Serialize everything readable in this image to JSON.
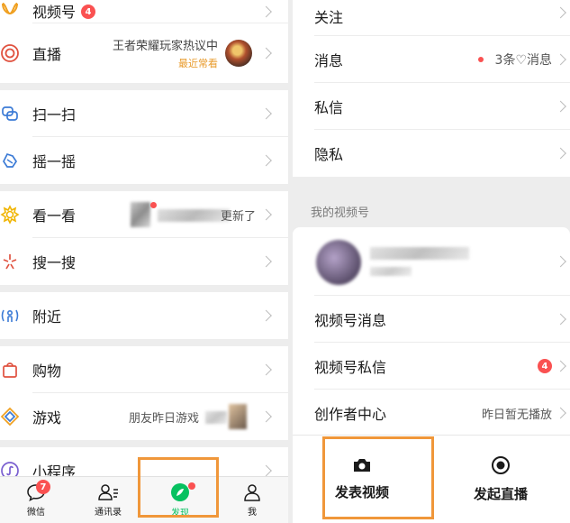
{
  "left": {
    "items": {
      "channels": {
        "label": "视频号",
        "badge": "4"
      },
      "live": {
        "label": "直播",
        "subtitle": "王者荣耀玩家热议中",
        "note": "最近常看"
      },
      "scan": {
        "label": "扫一扫"
      },
      "shake": {
        "label": "摇一摇"
      },
      "top_stories": {
        "label": "看一看",
        "subtitle": "更新了"
      },
      "search": {
        "label": "搜一搜"
      },
      "nearby": {
        "label": "附近"
      },
      "shopping": {
        "label": "购物"
      },
      "games": {
        "label": "游戏",
        "subtitle": "朋友昨日游戏"
      },
      "mini_programs": {
        "label": "小程序"
      }
    },
    "tabbar": {
      "chats": {
        "label": "微信",
        "badge": "7"
      },
      "contacts": {
        "label": "通讯录"
      },
      "discover": {
        "label": "发现"
      },
      "me": {
        "label": "我"
      }
    }
  },
  "right": {
    "items": {
      "follow": {
        "label": "关注"
      },
      "messages": {
        "label": "消息",
        "value": "3条♡消息"
      },
      "private_msg": {
        "label": "私信"
      },
      "privacy": {
        "label": "隐私"
      }
    },
    "section_label": "我的视频号",
    "channel_items": {
      "channel_messages": {
        "label": "视频号消息"
      },
      "channel_private": {
        "label": "视频号私信",
        "badge": "4"
      },
      "creator_center": {
        "label": "创作者中心",
        "value": "昨日暂无播放"
      }
    },
    "sheet": {
      "post_video": {
        "label": "发表视频"
      },
      "start_live": {
        "label": "发起直播"
      }
    }
  },
  "colors": {
    "accent_green": "#07c160",
    "badge_red": "#fa5151",
    "highlight_orange": "#f0973a"
  }
}
